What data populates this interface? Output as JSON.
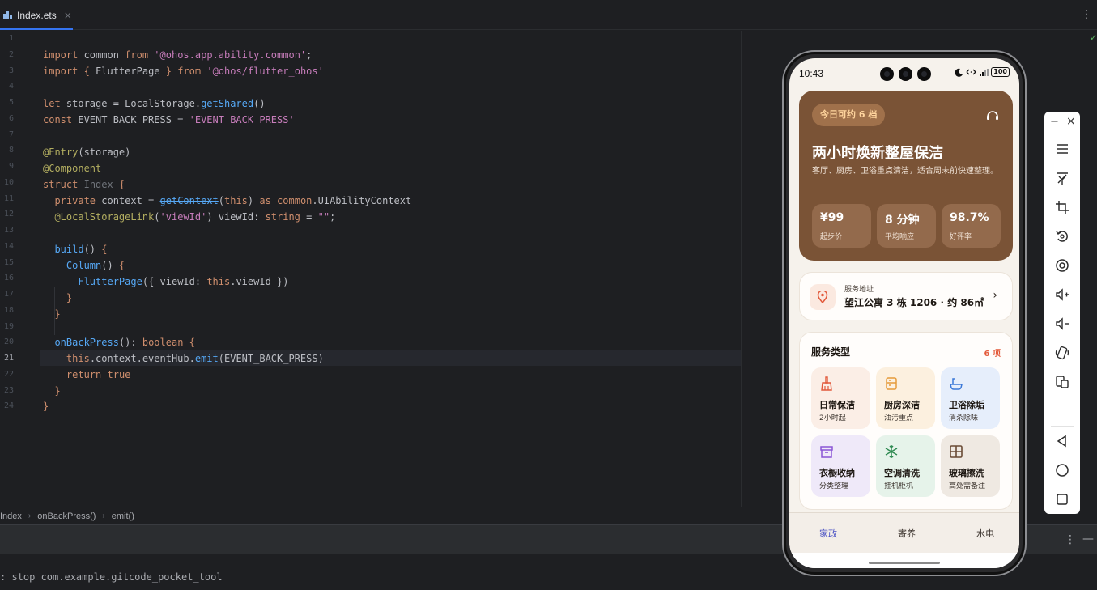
{
  "tab": {
    "file_name": "Index.ets",
    "close": "×",
    "more": "⋮"
  },
  "editor": {
    "line_numbers": [
      "1",
      "2",
      "3",
      "4",
      "5",
      "6",
      "7",
      "8",
      "9",
      "10",
      "11",
      "12",
      "13",
      "14",
      "15",
      "16",
      "17",
      "18",
      "19",
      "20",
      "21",
      "22",
      "23",
      "24"
    ],
    "active_line": "21"
  },
  "breadcrumb": {
    "items": [
      "Index",
      "onBackPress()",
      "emit()"
    ],
    "sep": "›"
  },
  "bottom_toolbar": {
    "more": "⋮",
    "minimize": "—"
  },
  "console": {
    "text": ": stop com.example.gitcode_pocket_tool"
  },
  "phone": {
    "status": {
      "time": "10:43",
      "battery": "100"
    },
    "hero": {
      "badge": "今日可约 6 档",
      "title": "两小时焕新整屋保洁",
      "subtitle": "客厅、厨房、卫浴重点清洁，适合周末前快速整理。",
      "stats": [
        {
          "value": "¥99",
          "label": "起步价"
        },
        {
          "value": "8 分钟",
          "label": "平均响应"
        },
        {
          "value": "98.7%",
          "label": "好评率"
        }
      ]
    },
    "address": {
      "label": "服务地址",
      "value": "望江公寓 3 栋 1206 · 约 86㎡",
      "chevron": "›"
    },
    "services": {
      "title": "服务类型",
      "count": "6 项",
      "items": [
        {
          "name": "日常保洁",
          "desc": "2小时起",
          "icon": "broom-icon",
          "bg": "#fbeee6",
          "color": "#e2593b"
        },
        {
          "name": "厨房深洁",
          "desc": "油污重点",
          "icon": "kitchen-icon",
          "bg": "#fcf0df",
          "color": "#e59a3a"
        },
        {
          "name": "卫浴除垢",
          "desc": "消杀除味",
          "icon": "bath-icon",
          "bg": "#e6eefb",
          "color": "#3b78d8"
        },
        {
          "name": "衣橱收纳",
          "desc": "分类整理",
          "icon": "box-icon",
          "bg": "#efe9f9",
          "color": "#8a55d6"
        },
        {
          "name": "空调清洗",
          "desc": "挂机柜机",
          "icon": "snowflake-icon",
          "bg": "#e6f3ea",
          "color": "#2f8a52"
        },
        {
          "name": "玻璃擦洗",
          "desc": "高处需备注",
          "icon": "window-icon",
          "bg": "#efe9e2",
          "color": "#6a4b35"
        }
      ]
    },
    "nav": [
      {
        "label": "家政",
        "active": true
      },
      {
        "label": "寄养",
        "active": false
      },
      {
        "label": "水电",
        "active": false
      }
    ]
  },
  "emulator_toolbar": {
    "minimize": "−",
    "close": "×",
    "buttons": [
      "menu-icon",
      "fold-icon",
      "crop-icon",
      "rotate-icon",
      "record-icon",
      "volume-up-icon",
      "volume-down-icon",
      "shake-icon",
      "multiscreen-icon",
      "back-icon",
      "home-icon",
      "recents-icon"
    ]
  },
  "colors": {
    "accent": "#3574f0",
    "hero_bg": "#7a5336",
    "nav_active": "#4b52c4",
    "count_red": "#e35a3b"
  }
}
